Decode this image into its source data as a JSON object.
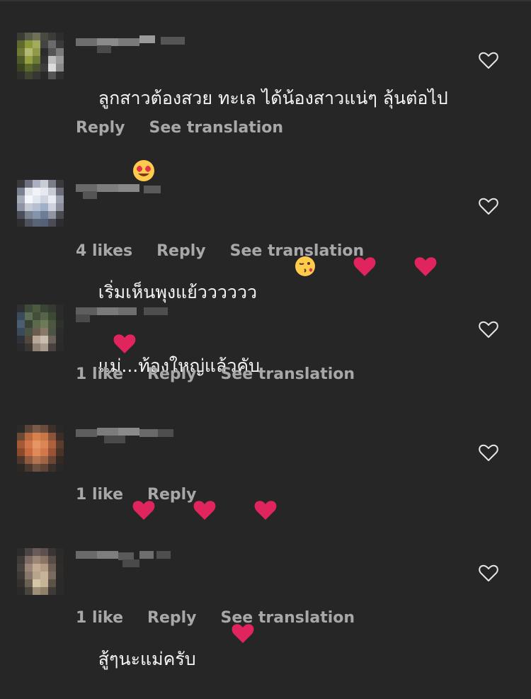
{
  "comments": [
    {
      "username": "",
      "text": "ลูกสาวต้องสวย ทะเล ได้น้องสาวแน่ๆ ลุ้นต่อไป",
      "emojis": [
        "heart-eyes-emoji"
      ],
      "likes": "",
      "reply_label": "Reply",
      "translate_label": "See translation"
    },
    {
      "username": "",
      "text": "เริ่มเห็นพุงแย้วววววว",
      "emojis": [
        "kissing-face-emoji",
        "red-heart-emoji",
        "red-heart-emoji",
        "red-heart-emoji"
      ],
      "likes": "4 likes",
      "reply_label": "Reply",
      "translate_label": "See translation"
    },
    {
      "username": "",
      "text": "แม่...ท้องใหญ่แล้วคับ",
      "emojis": [],
      "likes": "1 like",
      "reply_label": "Reply",
      "translate_label": "See translation"
    },
    {
      "username": "",
      "text": "",
      "emojis": [
        "red-heart-emoji",
        "red-heart-emoji",
        "red-heart-emoji"
      ],
      "likes": "1 like",
      "reply_label": "Reply",
      "translate_label": ""
    },
    {
      "username": "",
      "text": "สู้ๆนะแม่ครับ",
      "emojis": [
        "red-heart-emoji"
      ],
      "likes": "1 like",
      "reply_label": "Reply",
      "translate_label": "See translation"
    }
  ],
  "colors": {
    "background": "#262626",
    "text": "#f5f5f5",
    "secondary": "#a8a8a8",
    "heart": "#e0245e"
  },
  "icons": {
    "like": "heart-outline-icon"
  }
}
